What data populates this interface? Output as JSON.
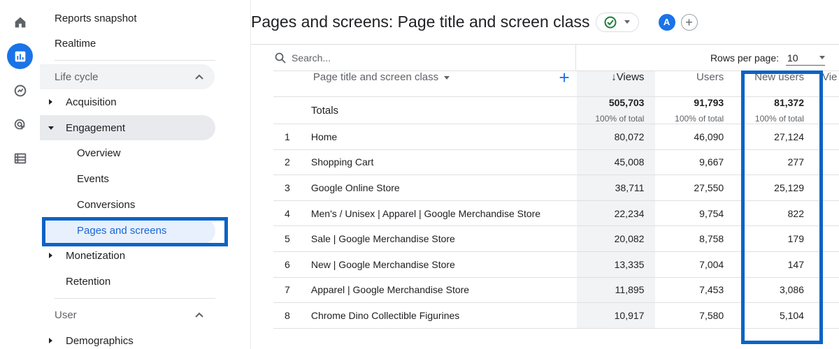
{
  "header": {
    "title": "Pages and screens: Page title and screen class",
    "avatar_letter": "A",
    "add_symbol": "+"
  },
  "nav": {
    "top_items": [
      "Reports snapshot",
      "Realtime"
    ],
    "lifecycle_label": "Life cycle",
    "acquisition": "Acquisition",
    "engagement": "Engagement",
    "engagement_children": [
      "Overview",
      "Events",
      "Conversions",
      "Pages and screens"
    ],
    "monetization": "Monetization",
    "retention": "Retention",
    "user_label": "User",
    "demographics": "Demographics"
  },
  "toolbar": {
    "search_placeholder": "Search...",
    "rows_per_page_label": "Rows per page:",
    "rows_per_page_value": "10"
  },
  "table": {
    "dimension_header": "Page title and screen class",
    "columns": [
      "↓Views",
      "Users",
      "New users",
      "Vie"
    ],
    "totals": {
      "label": "Totals",
      "views": "505,703",
      "users": "91,793",
      "new_users": "81,372",
      "pct": "100% of total"
    },
    "rows": [
      {
        "idx": "1",
        "name": "Home",
        "views": "80,072",
        "users": "46,090",
        "new_users": "27,124"
      },
      {
        "idx": "2",
        "name": "Shopping Cart",
        "views": "45,008",
        "users": "9,667",
        "new_users": "277"
      },
      {
        "idx": "3",
        "name": "Google Online Store",
        "views": "38,711",
        "users": "27,550",
        "new_users": "25,129"
      },
      {
        "idx": "4",
        "name": "Men's / Unisex | Apparel | Google Merchandise Store",
        "views": "22,234",
        "users": "9,754",
        "new_users": "822"
      },
      {
        "idx": "5",
        "name": "Sale | Google Merchandise Store",
        "views": "20,082",
        "users": "8,758",
        "new_users": "179"
      },
      {
        "idx": "6",
        "name": "New | Google Merchandise Store",
        "views": "13,335",
        "users": "7,004",
        "new_users": "147"
      },
      {
        "idx": "7",
        "name": "Apparel | Google Merchandise Store",
        "views": "11,895",
        "users": "7,453",
        "new_users": "3,086"
      },
      {
        "idx": "8",
        "name": "Chrome Dino Collectible Figurines",
        "views": "10,917",
        "users": "7,580",
        "new_users": "5,104"
      }
    ]
  },
  "colors": {
    "accent": "#1a73e8",
    "highlight_border": "#0b63c5",
    "status_ok": "#188038"
  }
}
